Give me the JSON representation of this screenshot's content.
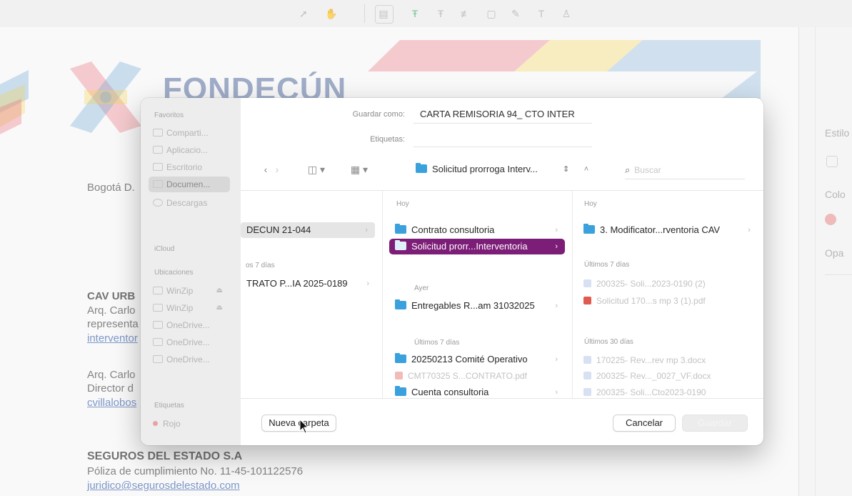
{
  "toolbar": {
    "icons": [
      "arrow-pointer-icon",
      "hand-icon",
      "text-box-icon",
      "text-align-icon",
      "text-align-center-icon",
      "text-align-justify-icon",
      "image-icon",
      "pen-icon",
      "text-icon",
      "stamp-icon"
    ]
  },
  "document": {
    "logo_text": "FONDECÚN",
    "city": "Bogotá D.",
    "lines": [
      "CAV URB",
      "Arq. Carlo",
      "representa"
    ],
    "link1": "interventor",
    "lines2": [
      "Arq. Carlo",
      "Director d"
    ],
    "link2": "cvillalobos",
    "insurer": "SEGUROS DEL ESTADO S.A",
    "policy": "Póliza de cumplimiento No. 11-45-101122576",
    "email": "juridico@segurosdelestado.com",
    "brand_colors": [
      "#e23b4e",
      "#f2c418",
      "#3a88c9",
      "#2c4a8a"
    ]
  },
  "right_panel": {
    "labels": [
      "Estilo",
      "Colo",
      "Opa"
    ]
  },
  "dialog": {
    "save_as_label": "Guardar como:",
    "save_as_value": "CARTA REMISORIA 94_ CTO INTER",
    "tags_label": "Etiquetas:",
    "tags_value": "",
    "location": "Solicitud prorroga Interv...",
    "search_placeholder": "Buscar",
    "sidebar": {
      "favorites_header": "Favoritos",
      "favorites": [
        "Comparti...",
        "Aplicacio...",
        "Escritorio",
        "Documen...",
        "Descargas"
      ],
      "icloud_header": "iCloud",
      "locations_header": "Ubicaciones",
      "locations": [
        "WinZip",
        "WinZip",
        "OneDrive...",
        "OneDrive...",
        "OneDrive..."
      ],
      "tags_header": "Etiquetas",
      "tags": [
        "Rojo"
      ]
    },
    "col1": {
      "item1": "DECUN 21-044",
      "header": "os 7 días",
      "item2": "TRATO P...IA 2025-0189"
    },
    "col2": {
      "header_today": "Hoy",
      "today": [
        "Contrato consultoria",
        "Solicitud prorr...Interventoria"
      ],
      "header_yesterday": "Ayer",
      "yesterday": [
        "Entregables R...am 31032025"
      ],
      "header_week": "Últimos 7 días",
      "week": [
        "20250213 Comité Operativo",
        "CMT70325 S...CONTRATO.pdf",
        "Cuenta consultoria"
      ]
    },
    "col3": {
      "header_today": "Hoy",
      "today": [
        "3. Modificator...rventoria CAV"
      ],
      "header_week": "Últimos 7 días",
      "week": [
        "200325- Soli...2023-0190 (2)",
        "Solicitud 170...s mp 3 (1).pdf"
      ],
      "header_month": "Últimos 30 días",
      "month": [
        "170225- Rev...rev mp 3.docx",
        "200325- Rev..._0027_VF.docx",
        "200325- Soli...Cto2023-0190"
      ]
    },
    "new_folder": "Nueva carpeta",
    "cancel": "Cancelar",
    "save": "Guardar",
    "accent_color": "#7c1d77"
  }
}
